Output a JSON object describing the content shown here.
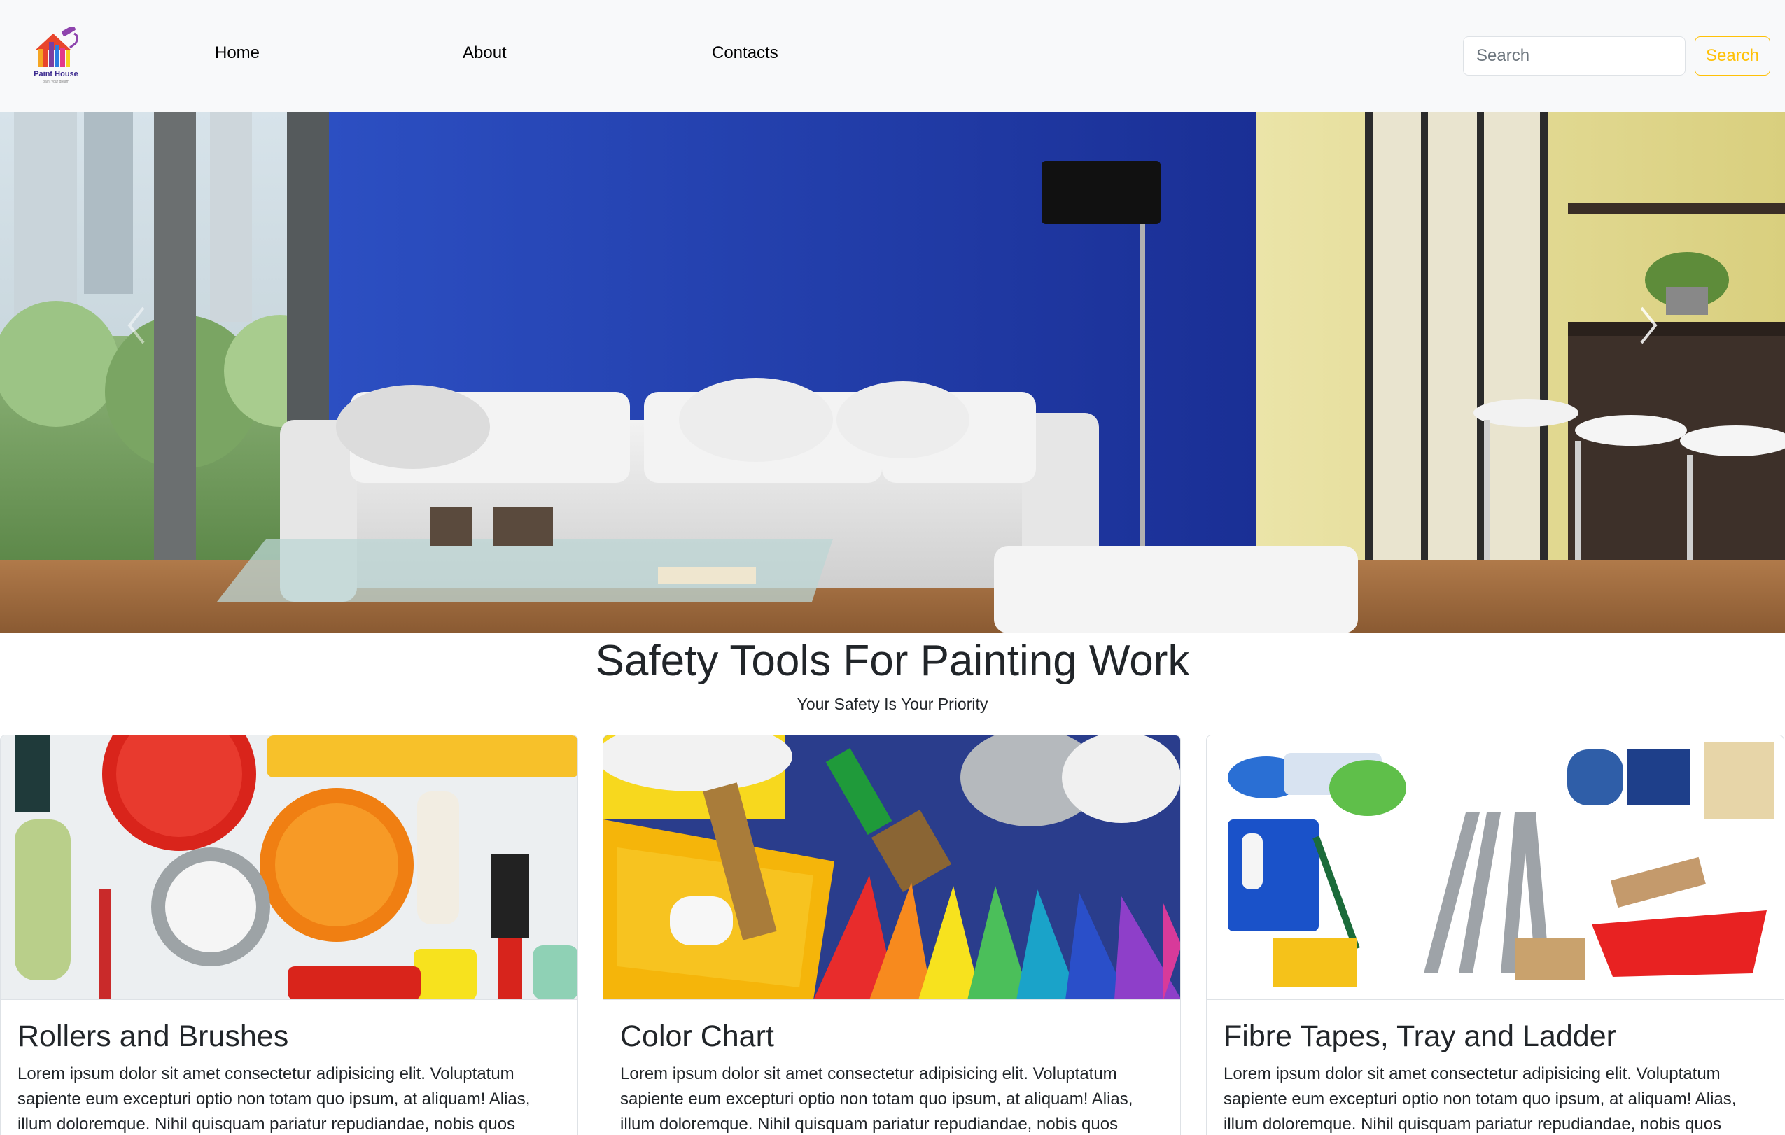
{
  "brand": {
    "name": "Paint House",
    "tagline": "paint your dream"
  },
  "nav": {
    "home": "Home",
    "about": "About",
    "contacts": "Contacts"
  },
  "search": {
    "placeholder": "Search",
    "button": "Search"
  },
  "colors": {
    "accent": "#ffc107",
    "navbar_bg": "#f8f9fa",
    "wall_blue": "#1e3aa8"
  },
  "hero": {
    "prev_icon": "chevron-left-icon",
    "next_icon": "chevron-right-icon"
  },
  "section": {
    "title": "Safety Tools For Painting Work",
    "subtitle": "Your Safety Is Your Priority"
  },
  "cards": [
    {
      "title": "Rollers and Brushes",
      "text": "Lorem ipsum dolor sit amet consectetur adipisicing elit. Voluptatum sapiente eum excepturi optio non totam quo ipsum, at aliquam! Alias, illum doloremque. Nihil quisquam pariatur repudiandae, nobis quos"
    },
    {
      "title": "Color Chart",
      "text": "Lorem ipsum dolor sit amet consectetur adipisicing elit. Voluptatum sapiente eum excepturi optio non totam quo ipsum, at aliquam! Alias, illum doloremque. Nihil quisquam pariatur repudiandae, nobis quos"
    },
    {
      "title": "Fibre Tapes, Tray and Ladder",
      "text": "Lorem ipsum dolor sit amet consectetur adipisicing elit. Voluptatum sapiente eum excepturi optio non totam quo ipsum, at aliquam! Alias, illum doloremque. Nihil quisquam pariatur repudiandae, nobis quos"
    }
  ]
}
